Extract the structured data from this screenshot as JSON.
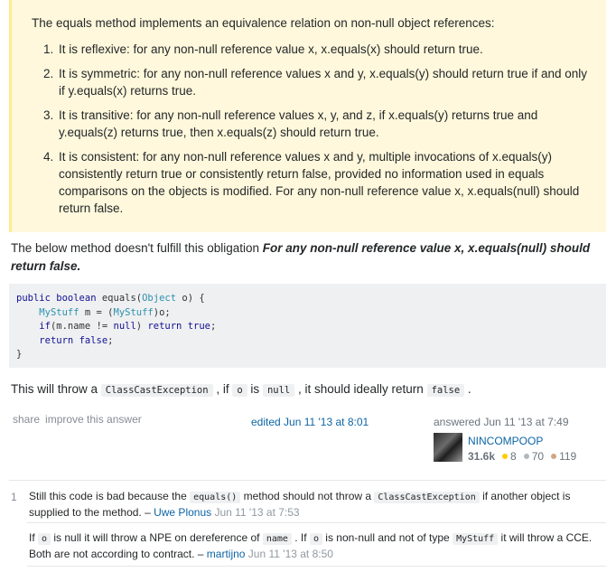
{
  "quote": {
    "intro": "The equals method implements an equivalence relation on non-null object references:",
    "items": [
      "It is reflexive: for any non-null reference value x, x.equals(x) should return true.",
      "It is symmetric: for any non-null reference values x and y, x.equals(y) should return true if and only if y.equals(x) returns true.",
      "It is transitive: for any non-null reference values x, y, and z, if x.equals(y) returns true and y.equals(z) returns true, then x.equals(z) should return true.",
      "It is consistent: for any non-null reference values x and y, multiple invocations of x.equals(y) consistently return true or consistently return false, provided no information used in equals comparisons on the objects is modified. For any non-null reference value x, x.equals(null) should return false."
    ]
  },
  "answer": {
    "para_prefix": "The below method doesn't fulfill this obligation ",
    "para_bold": "For any non-null reference value x, x.equals(null) should return false.",
    "code": {
      "l1_a": "public",
      "l1_b": "boolean",
      "l1_c": " equals(",
      "l1_d": "Object",
      "l1_e": " o) {",
      "l2_a": "    ",
      "l2_b": "MyStuff",
      "l2_c": " m = (",
      "l2_d": "MyStuff",
      "l2_e": ")o;",
      "l3_a": "    ",
      "l3_b": "if",
      "l3_c": "(m.name != ",
      "l3_d": "null",
      "l3_e": ") ",
      "l3_f": "return",
      "l3_g": "true",
      "l3_h": ";",
      "l4_a": "    ",
      "l4_b": "return",
      "l4_c": "false",
      "l4_d": ";",
      "l5": "}"
    },
    "para2": {
      "t1": "This will throw a ",
      "c1": "ClassCastException",
      "t2": " , if ",
      "c2": "o",
      "t3": " is ",
      "c3": "null",
      "t4": " , it should ideally return ",
      "c4": "false",
      "t5": " ."
    },
    "menu": {
      "share": "share",
      "improve": "improve this answer"
    },
    "edited": "edited Jun 11 '13 at 8:01",
    "answered": "answered Jun 11 '13 at 7:49",
    "user": {
      "name": "NINCOMPOOP",
      "rep": "31.6k",
      "gold": "8",
      "silver": "70",
      "bronze": "119"
    }
  },
  "comments": [
    {
      "score": "1",
      "t1": "Still this code is bad because the ",
      "c1": "equals()",
      "t2": " method should not throw a ",
      "c2": "ClassCastException",
      "t3": " if another object is supplied to the method. – ",
      "user": "Uwe Plonus",
      "date": " Jun 11 '13 at 7:53"
    },
    {
      "t1": "If ",
      "c1": "o",
      "t2": " is null it will throw a NPE on dereference of ",
      "c2": "name",
      "t3": " . If ",
      "c3": "o",
      "t4": " is non-null and not of type ",
      "c4": "MyStuff",
      "t5": " it will throw a CCE. Both are not according to contract. – ",
      "user": "martijno",
      "date": " Jun 11 '13 at 8:50"
    }
  ],
  "colors": {
    "quote_bg": "#fff8dc",
    "quote_border": "#ffeb8e",
    "link": "#0c65a5",
    "code_bg": "#eff0f1"
  }
}
